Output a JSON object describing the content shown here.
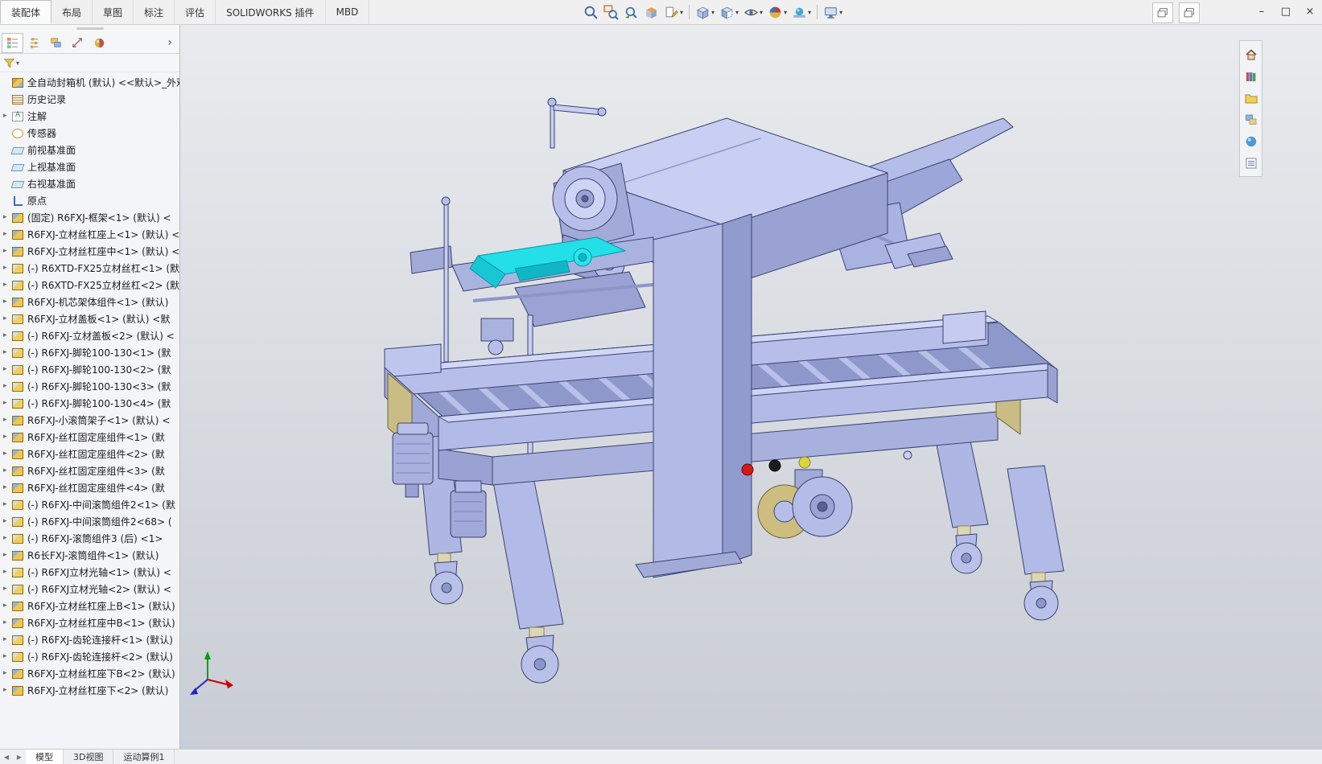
{
  "titlebar": {
    "doc_window_buttons": [
      {
        "name": "restore-doc-window",
        "icon": "window-restore"
      },
      {
        "name": "new-doc-window",
        "icon": "window-restore"
      }
    ],
    "window_controls": [
      {
        "name": "minimize",
        "glyph": "–"
      },
      {
        "name": "maximize",
        "glyph": "□"
      },
      {
        "name": "close",
        "glyph": "×"
      }
    ]
  },
  "ribbon_tabs": [
    {
      "label": "装配体",
      "active": true
    },
    {
      "label": "布局",
      "active": false
    },
    {
      "label": "草图",
      "active": false
    },
    {
      "label": "标注",
      "active": false
    },
    {
      "label": "评估",
      "active": false
    },
    {
      "label": "SOLIDWORKS 插件",
      "active": false
    },
    {
      "label": "MBD",
      "active": false
    }
  ],
  "headsup_toolbar": [
    {
      "name": "zoom-to-fit",
      "icon": "magnifier"
    },
    {
      "name": "zoom-to-area",
      "icon": "magnifier-area"
    },
    {
      "name": "previous-view",
      "icon": "magnifier-prev"
    },
    {
      "name": "section-view",
      "icon": "section"
    },
    {
      "name": "dynamic-annotation-views",
      "icon": "annotation-view",
      "dropdown": true
    },
    {
      "type": "sep"
    },
    {
      "name": "view-orientation",
      "icon": "cube",
      "dropdown": true
    },
    {
      "name": "display-style",
      "icon": "display-style",
      "dropdown": true
    },
    {
      "name": "hide-show-items",
      "icon": "eye",
      "dropdown": true
    },
    {
      "name": "edit-appearance",
      "icon": "appearance",
      "dropdown": true
    },
    {
      "name": "apply-scene",
      "icon": "scene",
      "dropdown": true
    },
    {
      "type": "sep"
    },
    {
      "name": "view-settings",
      "icon": "monitor",
      "dropdown": true
    }
  ],
  "caret_glyph": "▾",
  "left_panel": {
    "manager_tabs": [
      {
        "name": "featuremanager-tree",
        "icon": "fm-tree",
        "active": true
      },
      {
        "name": "propertymanager",
        "icon": "property",
        "active": false
      },
      {
        "name": "configurationmanager",
        "icon": "config",
        "active": false
      },
      {
        "name": "dimxpertmanager",
        "icon": "dimxpert",
        "active": false
      },
      {
        "name": "displaymanager",
        "icon": "display",
        "active": false
      }
    ],
    "expand_glyph": "›",
    "filter": {
      "name": "filter",
      "icon": "filter"
    },
    "tree": {
      "root": {
        "label": "全自动封箱机 (默认) <<默认>_外观",
        "icon": "assembly"
      },
      "items": [
        {
          "icon": "history",
          "label": "历史记录",
          "expand": false
        },
        {
          "icon": "annotations",
          "label": "注解",
          "expand": true
        },
        {
          "icon": "sensors",
          "label": "传感器",
          "expand": false
        },
        {
          "icon": "plane",
          "label": "前视基准面",
          "expand": false
        },
        {
          "icon": "plane",
          "label": "上视基准面",
          "expand": false
        },
        {
          "icon": "plane",
          "label": "右视基准面",
          "expand": false
        },
        {
          "icon": "origin",
          "label": "原点",
          "expand": false
        },
        {
          "icon": "asm",
          "label": "(固定) R6FXJ-框架<1> (默认) <",
          "expand": true
        },
        {
          "icon": "asm",
          "label": "R6FXJ-立材丝杠座上<1> (默认) <",
          "expand": true
        },
        {
          "icon": "asm",
          "label": "R6FXJ-立材丝杠座中<1> (默认) <",
          "expand": true
        },
        {
          "icon": "part",
          "label": "(-) R6XTD-FX25立材丝杠<1> (默",
          "expand": true
        },
        {
          "icon": "part",
          "label": "(-) R6XTD-FX25立材丝杠<2> (默",
          "expand": true
        },
        {
          "icon": "asm",
          "label": "R6FXJ-机芯架体组件<1> (默认)",
          "expand": true
        },
        {
          "icon": "part",
          "label": "R6FXJ-立材盖板<1> (默认) <默",
          "expand": true
        },
        {
          "icon": "part",
          "label": "(-) R6FXJ-立材盖板<2> (默认) <",
          "expand": true
        },
        {
          "icon": "part",
          "label": "(-) R6FXJ-脚轮100-130<1> (默",
          "expand": true
        },
        {
          "icon": "part",
          "label": "(-) R6FXJ-脚轮100-130<2> (默",
          "expand": true
        },
        {
          "icon": "part",
          "label": "(-) R6FXJ-脚轮100-130<3> (默",
          "expand": true
        },
        {
          "icon": "part",
          "label": "(-) R6FXJ-脚轮100-130<4> (默",
          "expand": true
        },
        {
          "icon": "asm",
          "label": "R6FXJ-小滚筒架子<1> (默认) <",
          "expand": true
        },
        {
          "icon": "asm",
          "label": "R6FXJ-丝杠固定座组件<1> (默",
          "expand": true
        },
        {
          "icon": "asm",
          "label": "R6FXJ-丝杠固定座组件<2> (默",
          "expand": true
        },
        {
          "icon": "asm",
          "label": "R6FXJ-丝杠固定座组件<3> (默",
          "expand": true
        },
        {
          "icon": "asm",
          "label": "R6FXJ-丝杠固定座组件<4> (默",
          "expand": true
        },
        {
          "icon": "part",
          "label": "(-) R6FXJ-中间滚筒组件2<1> (默",
          "expand": true
        },
        {
          "icon": "part",
          "label": "(-) R6FXJ-中间滚筒组件2<68> (",
          "expand": true
        },
        {
          "icon": "part",
          "label": "(-) R6FXJ-滚筒组件3 (后) <1>",
          "expand": true
        },
        {
          "icon": "asm",
          "label": "R6长FXJ-滚筒组件<1> (默认)",
          "expand": true
        },
        {
          "icon": "part",
          "label": "(-) R6FXJ立材光轴<1> (默认) <",
          "expand": true
        },
        {
          "icon": "part",
          "label": "(-) R6FXJ立材光轴<2> (默认) <",
          "expand": true
        },
        {
          "icon": "asm",
          "label": "R6FXJ-立材丝杠座上B<1> (默认)",
          "expand": true
        },
        {
          "icon": "asm",
          "label": "R6FXJ-立材丝杠座中B<1> (默认)",
          "expand": true
        },
        {
          "icon": "part",
          "label": "(-) R6FXJ-齿轮连接杆<1> (默认)",
          "expand": true
        },
        {
          "icon": "part",
          "label": "(-) R6FXJ-齿轮连接杆<2> (默认)",
          "expand": true
        },
        {
          "icon": "asm",
          "label": "R6FXJ-立材丝杠座下B<2> (默认)",
          "expand": true
        },
        {
          "icon": "asm",
          "label": "R6FXJ-立材丝杠座下<2> (默认)",
          "expand": true
        }
      ]
    }
  },
  "taskpane": [
    {
      "name": "home",
      "icon": "home"
    },
    {
      "name": "design-library",
      "icon": "design-library"
    },
    {
      "name": "file-explorer",
      "icon": "file-explorer"
    },
    {
      "name": "view-palette",
      "icon": "view-palette"
    },
    {
      "name": "appearances-scenes",
      "icon": "sphere"
    },
    {
      "name": "custom-properties",
      "icon": "list"
    }
  ],
  "bottom_bar": {
    "nav_glyphs": [
      "◀",
      "▶"
    ],
    "tabs": [
      {
        "label": "模型",
        "active": true
      },
      {
        "label": "3D视图",
        "active": false
      },
      {
        "label": "运动算例1",
        "active": false
      }
    ]
  },
  "viewport": {
    "model_color": "#b9c1e9",
    "highlight_color": "#22dfe8",
    "background_top": "#e9ebee",
    "background_bottom": "#c9cdd5"
  }
}
